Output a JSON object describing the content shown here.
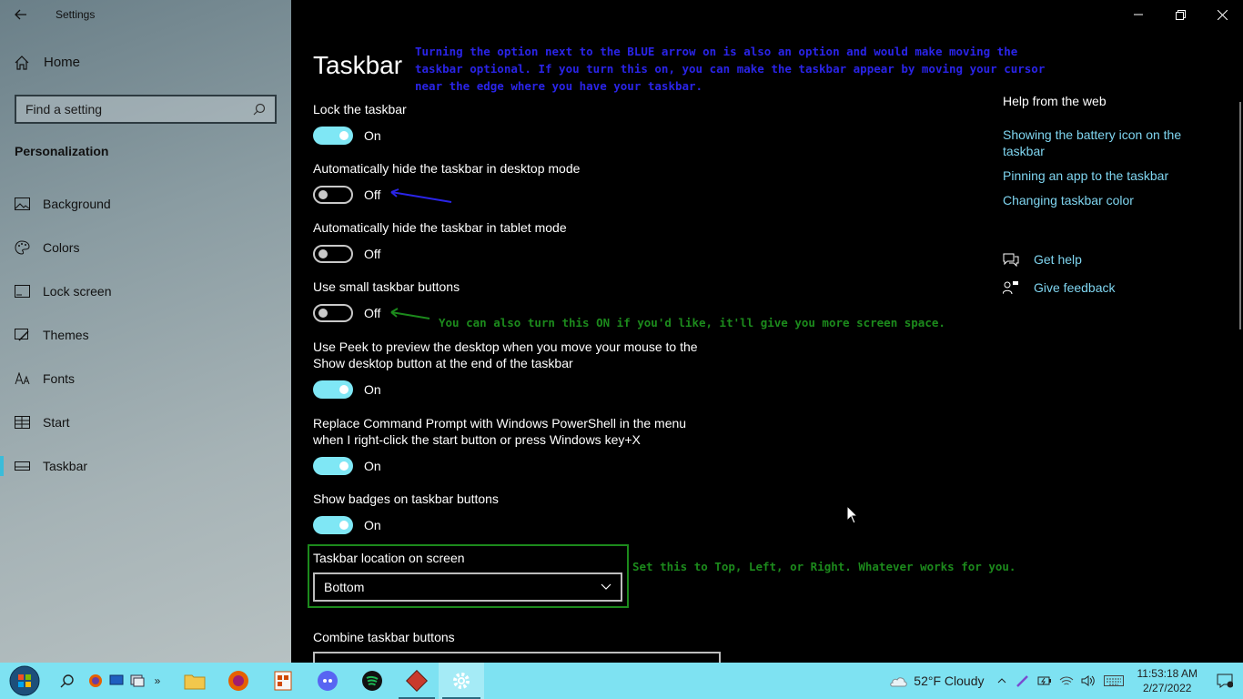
{
  "window": {
    "title": "Settings"
  },
  "sidebar": {
    "home_label": "Home",
    "search_placeholder": "Find a setting",
    "section_title": "Personalization",
    "items": [
      {
        "label": "Background",
        "icon": "picture-icon"
      },
      {
        "label": "Colors",
        "icon": "palette-icon"
      },
      {
        "label": "Lock screen",
        "icon": "lock-screen-icon"
      },
      {
        "label": "Themes",
        "icon": "themes-brush-icon"
      },
      {
        "label": "Fonts",
        "icon": "fonts-icon"
      },
      {
        "label": "Start",
        "icon": "start-grid-icon"
      },
      {
        "label": "Taskbar",
        "icon": "taskbar-icon",
        "active": true
      }
    ]
  },
  "main": {
    "title": "Taskbar",
    "settings": [
      {
        "label": "Lock the taskbar",
        "state": "On"
      },
      {
        "label": "Automatically hide the taskbar in desktop mode",
        "state": "Off"
      },
      {
        "label": "Automatically hide the taskbar in tablet mode",
        "state": "Off"
      },
      {
        "label": "Use small taskbar buttons",
        "state": "Off"
      },
      {
        "label": "Use Peek to preview the desktop when you move your mouse to the Show desktop button at the end of the taskbar",
        "state": "On"
      },
      {
        "label": "Replace Command Prompt with Windows PowerShell in the menu when I right-click the start button or press Windows key+X",
        "state": "On"
      },
      {
        "label": "Show badges on taskbar buttons",
        "state": "On"
      }
    ],
    "location": {
      "label": "Taskbar location on screen",
      "value": "Bottom"
    },
    "combine_label": "Combine taskbar buttons"
  },
  "annotations": {
    "blue_note": "Turning the option next to the BLUE arrow on is also an option and would make moving the taskbar optional. If you turn this on, you can make the taskbar appear by moving your cursor near the edge where you have your taskbar.",
    "green_note_1": "You can also turn this ON if you'd like, it'll give you more screen space.",
    "green_note_2": "Set this to Top, Left, or Right. Whatever works for you.",
    "blue_color": "#2a24e8",
    "green_color": "#1c8a1c"
  },
  "help": {
    "title": "Help from the web",
    "links": [
      "Showing the battery icon on the taskbar",
      "Pinning an app to the taskbar",
      "Changing taskbar color"
    ],
    "get_help": "Get help",
    "give_feedback": "Give feedback"
  },
  "taskbar": {
    "weather": "52°F  Cloudy",
    "time": "11:53:18 AM",
    "date": "2/27/2022",
    "accent_color": "#7ee2f2"
  }
}
